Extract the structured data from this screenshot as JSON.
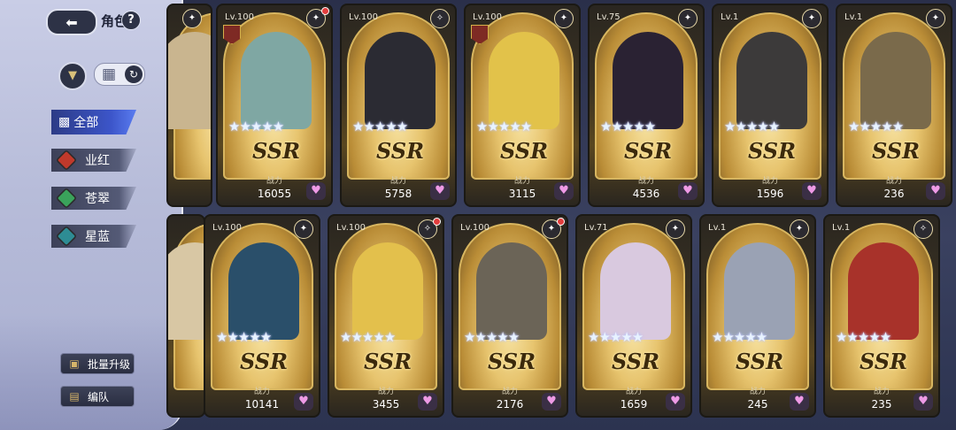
{
  "header": {
    "title": "角色",
    "help": "?"
  },
  "sidebar": {
    "categories": [
      {
        "label": "全部",
        "color": "#3c55c9"
      },
      {
        "label": "业红",
        "color": "#c0392b"
      },
      {
        "label": "苍翠",
        "color": "#3aa35b"
      },
      {
        "label": "星蓝",
        "color": "#2e8c94"
      }
    ],
    "batch_upgrade": "批量升级",
    "formation": "编队"
  },
  "cards_row1": [
    {
      "level": "",
      "power": "",
      "element": "✦",
      "portrait": "#c9b58f"
    },
    {
      "level": "Lv.100",
      "power": "16055",
      "element": "✦",
      "portrait": "#7fa7a3"
    },
    {
      "level": "Lv.100",
      "power": "5758",
      "element": "✧",
      "portrait": "#2b2b33"
    },
    {
      "level": "Lv.100",
      "power": "3115",
      "element": "✦",
      "portrait": "#e2c24a"
    },
    {
      "level": "Lv.75",
      "power": "4536",
      "element": "✦",
      "portrait": "#2a2233"
    },
    {
      "level": "Lv.1",
      "power": "1596",
      "element": "✦",
      "portrait": "#3c3a3a"
    },
    {
      "level": "Lv.1",
      "power": "236",
      "element": "✦",
      "portrait": "#7a6a4b"
    }
  ],
  "cards_row2": [
    {
      "level": "",
      "power": "",
      "element": "✦",
      "portrait": "#d8c7a4"
    },
    {
      "level": "Lv.100",
      "power": "10141",
      "element": "✦",
      "portrait": "#2a4f6a"
    },
    {
      "level": "Lv.100",
      "power": "3455",
      "element": "✧",
      "portrait": "#e3c04c"
    },
    {
      "level": "Lv.100",
      "power": "2176",
      "element": "✦",
      "portrait": "#6b6457"
    },
    {
      "level": "Lv.71",
      "power": "1659",
      "element": "✦",
      "portrait": "#d9c9df"
    },
    {
      "level": "Lv.1",
      "power": "245",
      "element": "✦",
      "portrait": "#9aa2b4"
    },
    {
      "level": "Lv.1",
      "power": "235",
      "element": "✧",
      "portrait": "#a8322a"
    }
  ],
  "card_common": {
    "power_label": "战力",
    "rarity": "SSR",
    "stars": "★★★★★"
  }
}
